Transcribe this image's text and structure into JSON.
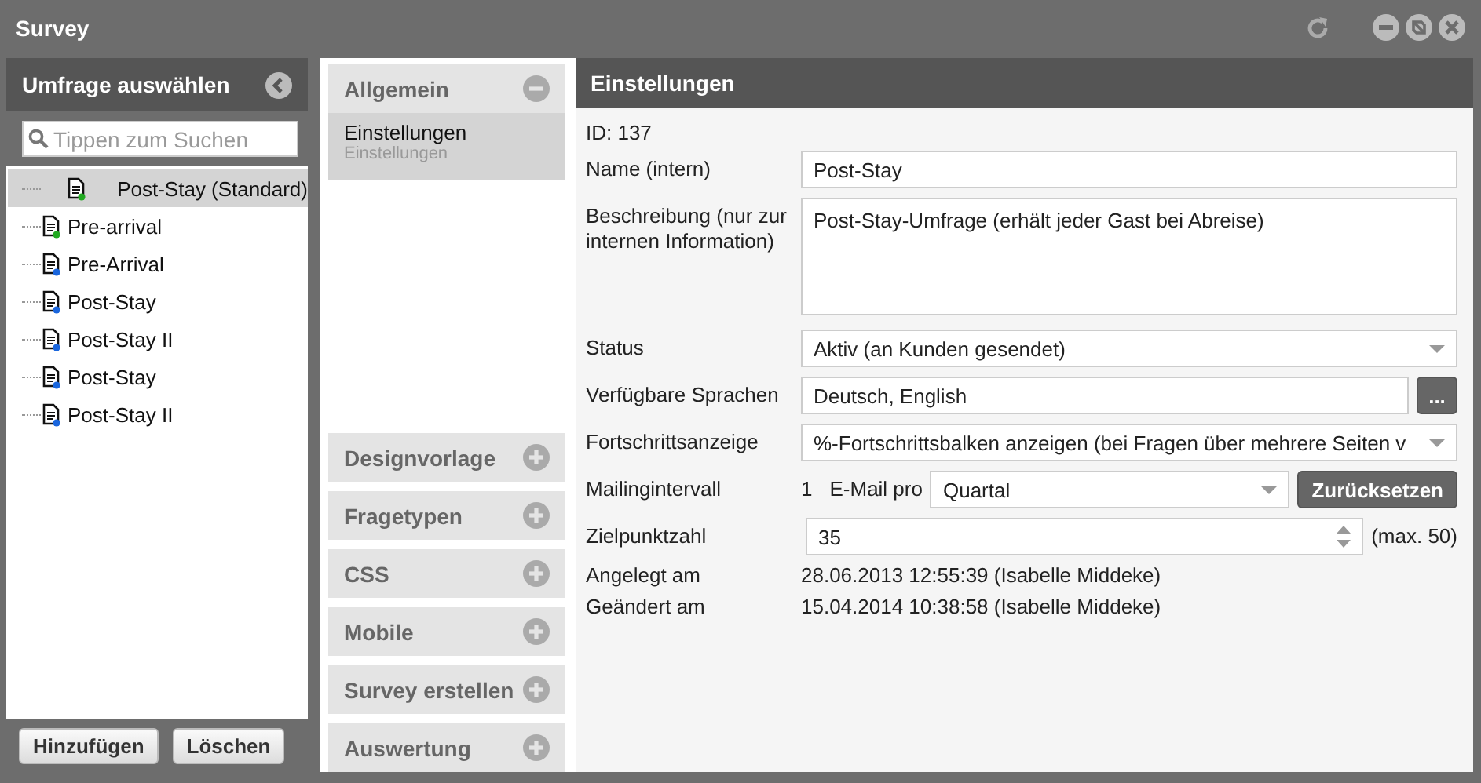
{
  "window": {
    "title": "Survey"
  },
  "sidebar": {
    "title": "Umfrage auswählen",
    "search": {
      "placeholder": "Tippen zum Suchen"
    },
    "items": [
      {
        "label": "Post-Stay (Standard)",
        "selected": true,
        "color": "#22aa22"
      },
      {
        "label": "Pre-arrival",
        "selected": false,
        "color": "#22aa22"
      },
      {
        "label": "Pre-Arrival",
        "selected": false,
        "color": "#1a66dd"
      },
      {
        "label": "Post-Stay",
        "selected": false,
        "color": "#1a66dd"
      },
      {
        "label": "Post-Stay II",
        "selected": false,
        "color": "#1a66dd"
      },
      {
        "label": "Post-Stay",
        "selected": false,
        "color": "#1a66dd"
      },
      {
        "label": "Post-Stay II",
        "selected": false,
        "color": "#1a66dd"
      }
    ],
    "buttons": [
      "Hinzufügen",
      "Löschen"
    ]
  },
  "sections": [
    {
      "title": "Allgemein",
      "expanded": true,
      "children": [
        {
          "label": "Einstellungen",
          "sublabel": "Einstellungen",
          "selected": true
        }
      ]
    },
    {
      "title": "Designvorlage",
      "expanded": false
    },
    {
      "title": "Fragetypen",
      "expanded": false
    },
    {
      "title": "CSS",
      "expanded": false
    },
    {
      "title": "Mobile",
      "expanded": false
    },
    {
      "title": "Survey erstellen",
      "expanded": false
    },
    {
      "title": "Auswertung",
      "expanded": false
    }
  ],
  "settings": {
    "title": "Einstellungen",
    "id_text": "ID: 137",
    "rows": [
      {
        "kind": "text",
        "label": "Name (intern)",
        "value": "Post-Stay"
      },
      {
        "kind": "textarea",
        "label": "Beschreibung (nur zur internen Information)",
        "value": "Post-Stay-Umfrage (erhält jeder Gast bei Abreise)"
      },
      {
        "kind": "select",
        "label": "Status",
        "value": "Aktiv (an Kunden gesendet)"
      },
      {
        "kind": "multi",
        "label": "Verfügbare Sprachen",
        "value": "Deutsch, English",
        "button": "..."
      },
      {
        "kind": "select",
        "label": "Fortschrittsanzeige",
        "value": "%-Fortschrittsbalken anzeigen (bei Fragen über mehrere Seiten v"
      },
      {
        "kind": "interval",
        "label": "Mailingintervall",
        "count": "1",
        "unit": "E-Mail pro",
        "value": "Quartal",
        "button": "Zurücksetzen"
      },
      {
        "kind": "number",
        "label": "Zielpunktzahl",
        "value": "35",
        "note": "(max. 50)"
      },
      {
        "kind": "info",
        "label": "Angelegt am",
        "value": "28.06.2013 12:55:39 (Isabelle Middeke)"
      },
      {
        "kind": "info",
        "label": "Geändert am",
        "value": "15.04.2014 10:38:58 (Isabelle Middeke)"
      }
    ]
  }
}
